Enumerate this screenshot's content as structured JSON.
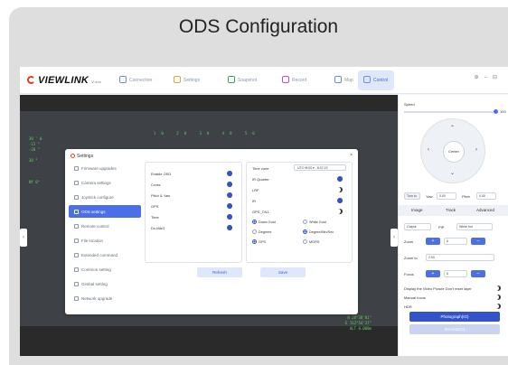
{
  "card": {
    "title": "ODS Configuration"
  },
  "app": {
    "logo": "VIEWLINK",
    "version": "V.xxx",
    "tabs": [
      "Connection",
      "Settings",
      "Snapshot",
      "Record",
      "Map",
      "Control"
    ],
    "active_tab": "Control",
    "window_controls": [
      "⊕",
      "–",
      "⊟"
    ]
  },
  "osd": {
    "left": "30 ' 0\n-15 °\n-20 °\n\n30 °\n\n\n\nNf 0°",
    "ticks": "10 20 30 40 50",
    "bottom_right": "N 28°30'01\"\nE 112°54'37\"\nALT 0.000m"
  },
  "dialog": {
    "title": "Settings",
    "close": "×",
    "sidebar": [
      {
        "label": "Firmware upgrades",
        "icon": "upload-icon"
      },
      {
        "label": "Camera settings",
        "icon": "camera-icon"
      },
      {
        "label": "Joystick configure",
        "icon": "joystick-icon"
      },
      {
        "label": "ODS settings",
        "icon": "sliders-icon",
        "active": true
      },
      {
        "label": "Remote control",
        "icon": "remote-icon"
      },
      {
        "label": "File location",
        "icon": "folder-icon"
      },
      {
        "label": "Extended command",
        "icon": "terminal-icon"
      },
      {
        "label": "Common setting",
        "icon": "gear-icon"
      },
      {
        "label": "Gimbal setting",
        "icon": "gimbal-icon"
      },
      {
        "label": "Network upgrade",
        "icon": "network-icon"
      }
    ],
    "left_rows": [
      {
        "label": "Enable OSD",
        "on": true
      },
      {
        "label": "Cross",
        "on": true
      },
      {
        "label": "Pitch & Yaw",
        "on": true
      },
      {
        "label": "GPS",
        "on": true
      },
      {
        "label": "Time",
        "on": true
      },
      {
        "label": "Dc-MAG",
        "on": true
      }
    ],
    "right": {
      "time_zone_label": "Time zone",
      "time_zone_value": "UTC+8:00 ▾ - 8:07:22",
      "toggles": [
        {
          "label": "IR Quarter",
          "on": true
        },
        {
          "label": "LRF",
          "on": false
        },
        {
          "label": "IR",
          "on": true
        },
        {
          "label": "GPS_CN1",
          "on": false
        }
      ],
      "radios": [
        {
          "left": "Down Guid",
          "right": "White Guid",
          "left_on": true,
          "right_on": false
        },
        {
          "left": "Degrees",
          "right": "Degree/Min/Sec",
          "left_on": false,
          "right_on": true
        },
        {
          "left": "GPS",
          "right": "MGRS",
          "left_on": true,
          "right_on": false
        }
      ]
    },
    "buttons": {
      "refresh": "Refresh",
      "save": "Save"
    }
  },
  "control": {
    "speed_label": "Speed",
    "speed_value": "100",
    "center_label": "Center",
    "turn_to_label": "Turn to",
    "yaw_label": "Yaw",
    "yaw_value": "0.00",
    "pitch_label": "Pitch",
    "pitch_value": "0.00",
    "tabs": [
      "Image",
      "Track",
      "Advanced"
    ],
    "output_value": "Output",
    "pip_label": "PIP",
    "white_hot": "White hot",
    "zoom_label": "Zoom",
    "zoom_value": "6",
    "zoom_to_label": "Zoom to",
    "zoom_to_value": "2.00",
    "focus_label": "Focus",
    "focus_value": "6",
    "check_lines": [
      "Display the Video Picture Don't reset layer",
      "Manual focus",
      "HDR"
    ],
    "photo_btn": "Photograph(IO)",
    "record_btn": "Record(IO)"
  }
}
